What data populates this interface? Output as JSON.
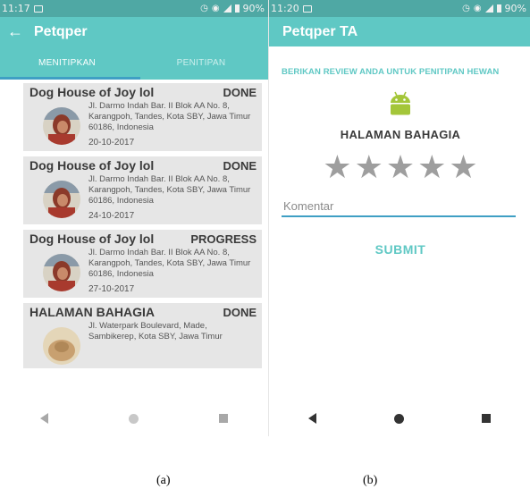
{
  "theme": {
    "primary": "#5fc8c4",
    "statusbar": "#4fa8a4",
    "accent": "#3f9fc4",
    "teal_text": "#5fc8c4",
    "android_green": "#a4c639"
  },
  "phone_a": {
    "statusbar": {
      "time": "11:17",
      "icons": [
        "image-icon",
        "alarm-icon",
        "wifi-icon",
        "signal-icon"
      ],
      "battery": "90%"
    },
    "appbar": {
      "back_icon": "arrow-left-icon",
      "back_glyph": "←",
      "title": "Petqper"
    },
    "tabs": [
      {
        "label": "MENITIPKAN"
      },
      {
        "label": "PENITIPAN"
      }
    ],
    "cards": [
      {
        "name": "Dog House of Joy lol",
        "status": "DONE",
        "address": "Jl. Darmo Indah Bar. II Blok AA No. 8, Karangpoh, Tandes, Kota SBY, Jawa Timur 60186, Indonesia",
        "date": "20-10-2017"
      },
      {
        "name": "Dog House of Joy lol",
        "status": "DONE",
        "address": "Jl. Darmo Indah Bar. II Blok AA No. 8, Karangpoh, Tandes, Kota SBY, Jawa Timur 60186, Indonesia",
        "date": "24-10-2017"
      },
      {
        "name": "Dog House of Joy lol",
        "status": "PROGRESS",
        "address": "Jl. Darmo Indah Bar. II Blok AA No. 8, Karangpoh, Tandes, Kota SBY, Jawa Timur 60186, Indonesia",
        "date": "27-10-2017"
      },
      {
        "name": "HALAMAN BAHAGIA",
        "status": "DONE",
        "address": "Jl. Waterpark Boulevard, Made, Sambikerep, Kota SBY, Jawa Timur",
        "date": ""
      }
    ]
  },
  "phone_b": {
    "statusbar": {
      "time": "11:20",
      "icons": [
        "image-icon",
        "alarm-icon",
        "wifi-icon",
        "signal-icon"
      ],
      "battery": "90%"
    },
    "appbar": {
      "title": "Petqper TA"
    },
    "review_heading": "BERIKAN REVIEW ANDA UNTUK PENITIPAN HEWAN",
    "shelter_name": "HALAMAN BAHAGIA",
    "rating": {
      "value": 0,
      "max": 5
    },
    "comment": {
      "value": "",
      "placeholder": "Komentar"
    },
    "submit_label": "SUBMIT"
  },
  "captions": {
    "a": "(a)",
    "b": "(b)"
  }
}
